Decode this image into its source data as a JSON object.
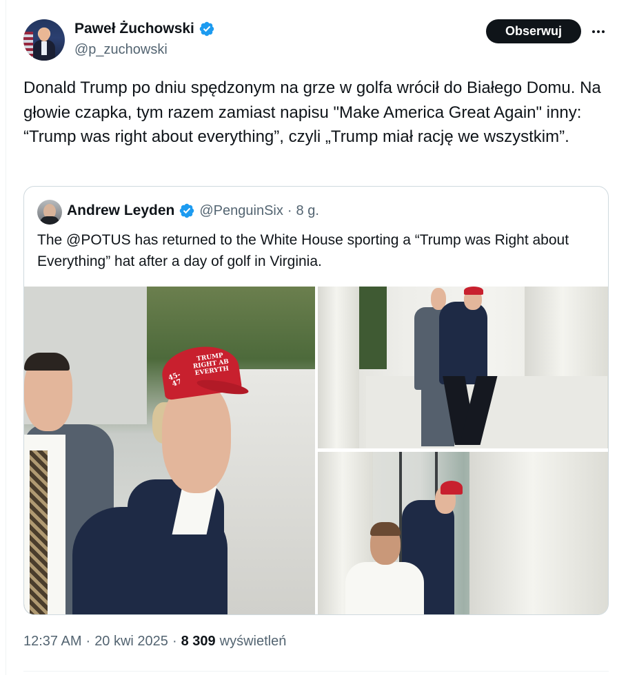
{
  "author": {
    "display_name": "Paweł Żuchowski",
    "handle": "@p_zuchowski",
    "verified_icon": "verified-badge-icon"
  },
  "actions": {
    "follow_label": "Obserwuj",
    "more_icon": "more-options-icon"
  },
  "tweet": {
    "text": "Donald Trump po dniu spędzonym na grze w golfa wrócił do Białego Domu. Na głowie czapka, tym razem zamiast napisu \"Make America Great Again\" inny:  “Trump was right about everything”, czyli „Trump miał rację we wszystkim”."
  },
  "quoted_tweet": {
    "display_name": "Andrew Leyden",
    "handle": "@PenguinSix",
    "separator": "·",
    "time": "8 g.",
    "text": "The @POTUS has returned to the White House sporting a “Trump was Right about Everything” hat after a day of golf in Virginia.",
    "hat_text_lines": [
      "TRUMP",
      "RIGHT AB",
      "EVERYTH"
    ],
    "hat_side_text": "45-47"
  },
  "footer": {
    "time": "12:37 AM",
    "sep1": "·",
    "date": "20 kwi 2025",
    "sep2": "·",
    "views_count": "8 309",
    "views_label": "wyświetleń"
  },
  "colors": {
    "accent": "#1d9bf0",
    "text_primary": "#0f1419",
    "text_secondary": "#536471",
    "border": "#cfd9de",
    "hat_red": "#c8202e"
  }
}
